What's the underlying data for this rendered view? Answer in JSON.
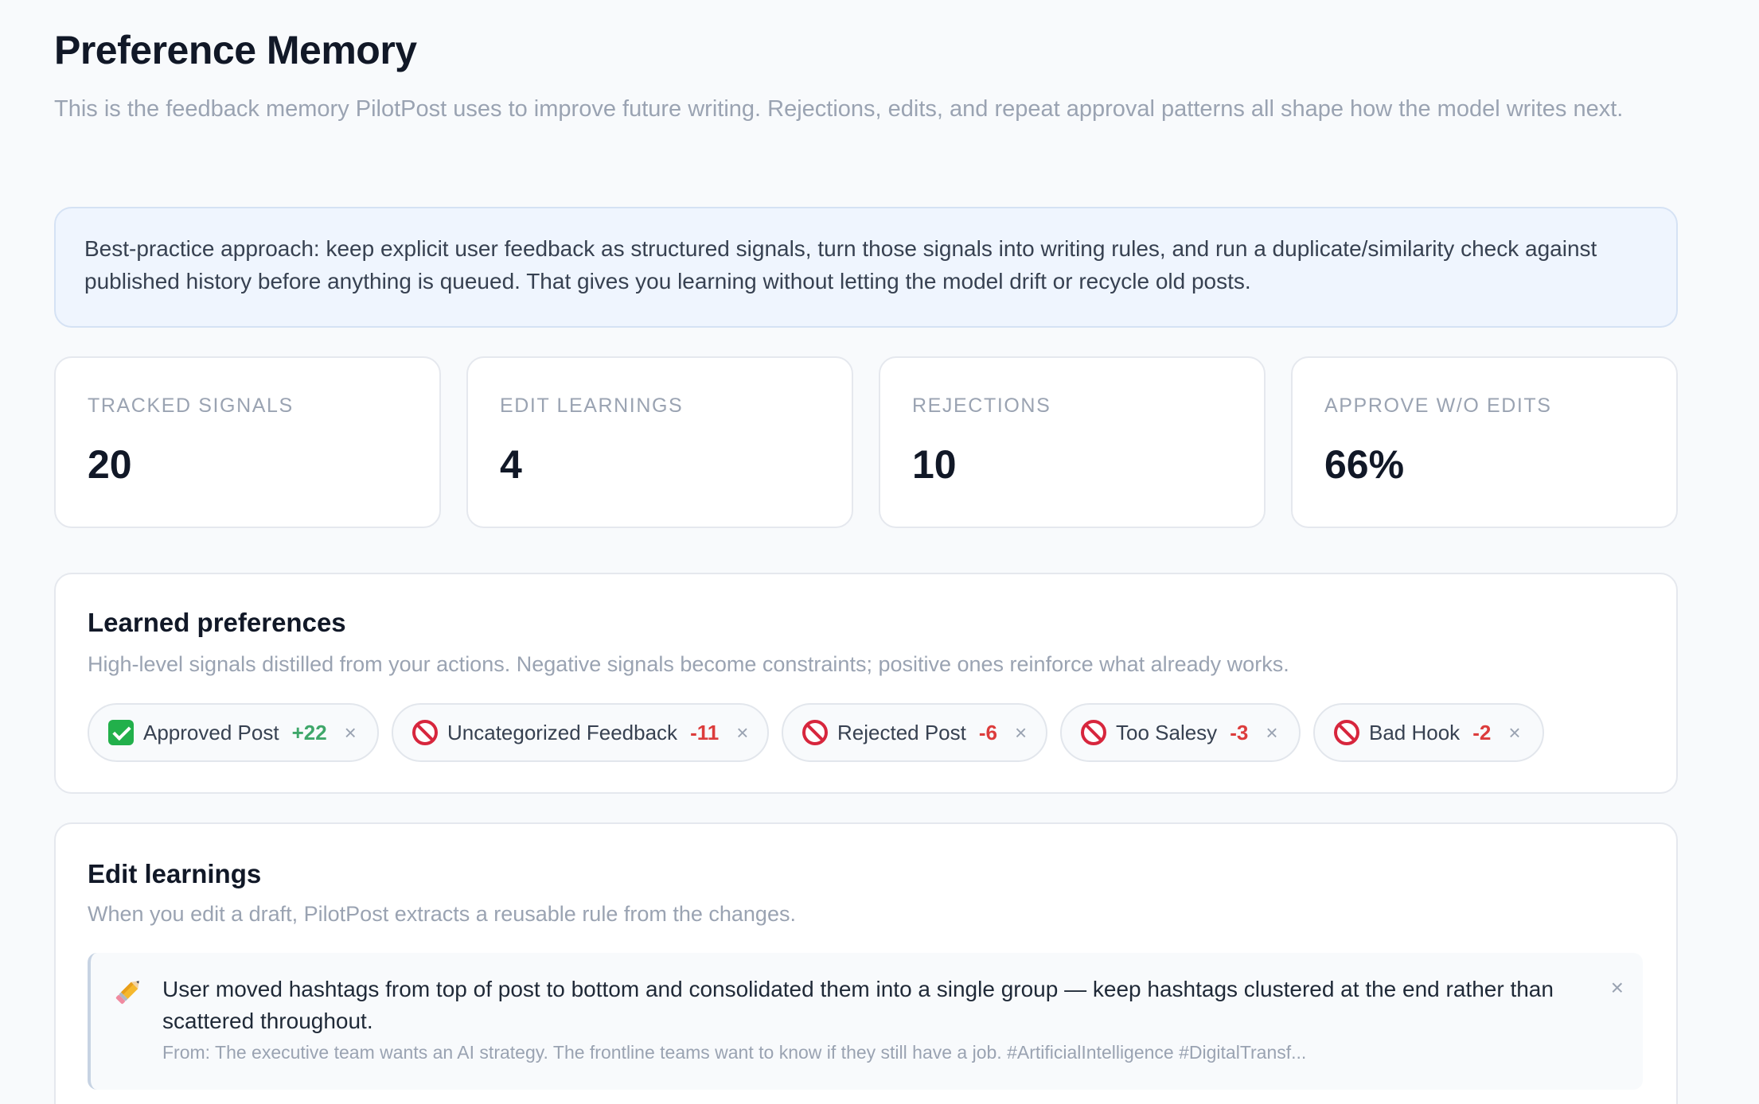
{
  "header": {
    "title": "Preference Memory",
    "subtitle": "This is the feedback memory PilotPost uses to improve future writing. Rejections, edits, and repeat approval patterns all shape how the model writes next."
  },
  "info": {
    "text": "Best-practice approach: keep explicit user feedback as structured signals, turn those signals into writing rules, and run a duplicate/similarity check against published history before anything is queued. That gives you learning without letting the model drift or recycle old posts."
  },
  "stats": [
    {
      "label": "TRACKED SIGNALS",
      "value": "20"
    },
    {
      "label": "EDIT LEARNINGS",
      "value": "4"
    },
    {
      "label": "REJECTIONS",
      "value": "10"
    },
    {
      "label": "APPROVE W/O EDITS",
      "value": "66%"
    }
  ],
  "preferences": {
    "title": "Learned preferences",
    "description": "High-level signals distilled from your actions. Negative signals become constraints; positive ones reinforce what already works.",
    "items": [
      {
        "icon": "check-mark-emoji-icon",
        "label": "Approved Post",
        "score": "+22",
        "remove": "×"
      },
      {
        "icon": "prohibited-emoji-icon",
        "label": "Uncategorized Feedback",
        "score": "-11",
        "remove": "×"
      },
      {
        "icon": "prohibited-emoji-icon",
        "label": "Rejected Post",
        "score": "-6",
        "remove": "×"
      },
      {
        "icon": "prohibited-emoji-icon",
        "label": "Too Salesy",
        "score": "-3",
        "remove": "×"
      },
      {
        "icon": "prohibited-emoji-icon",
        "label": "Bad Hook",
        "score": "-2",
        "remove": "×"
      }
    ]
  },
  "edits": {
    "title": "Edit learnings",
    "description": "When you edit a draft, PilotPost extracts a reusable rule from the changes.",
    "items": [
      {
        "icon": "pencil-emoji-icon",
        "rule": "User moved hashtags from top of post to bottom and consolidated them into a single group — keep hashtags clustered at the end rather than scattered throughout.",
        "source": "From: The executive team wants an AI strategy. The frontline teams want to know if they still have a job. #ArtificialIntelligence #DigitalTransf...",
        "remove": "×"
      }
    ]
  },
  "colors": {
    "positive": "#3fa76a",
    "negative": "#dc3c3c",
    "info_bg": "#eff5fe",
    "page_bg": "#f8fafc"
  }
}
